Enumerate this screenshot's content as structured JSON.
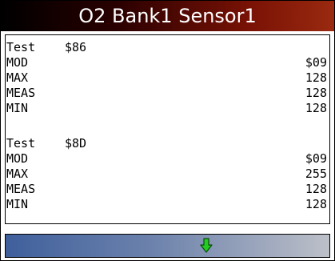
{
  "title": "O2 Bank1 Sensor1",
  "tests": [
    {
      "label": "Test",
      "code": "$86",
      "rows": [
        {
          "label": "MOD",
          "value": "$09"
        },
        {
          "label": "MAX",
          "value": "128"
        },
        {
          "label": "MEAS",
          "value": "128"
        },
        {
          "label": "MIN",
          "value": "128"
        }
      ]
    },
    {
      "label": "Test",
      "code": "$8D",
      "rows": [
        {
          "label": "MOD",
          "value": "$09"
        },
        {
          "label": "MAX",
          "value": "255"
        },
        {
          "label": "MEAS",
          "value": "128"
        },
        {
          "label": "MIN",
          "value": "128"
        }
      ]
    }
  ],
  "status_bar": {
    "icon": "arrow-down-icon",
    "icon_color": "#22cc22"
  },
  "colors": {
    "title_bg_start": "#000000",
    "title_bg_end": "#9a2a10",
    "status_bg_start": "#3f5f9c",
    "status_bg_end": "#bcc0c8"
  }
}
